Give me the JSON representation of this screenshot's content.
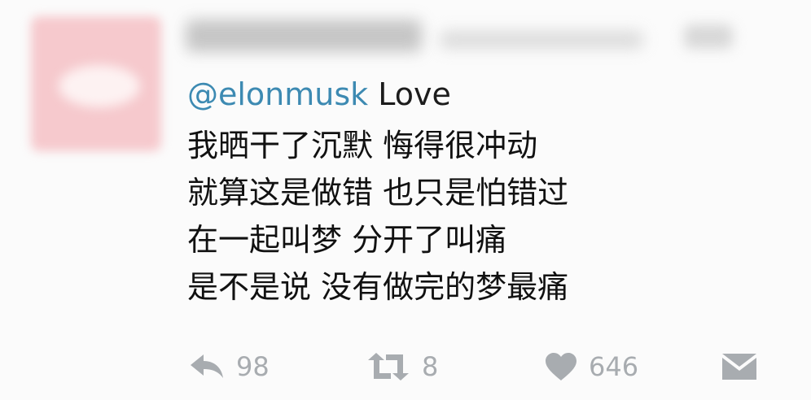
{
  "tweet": {
    "mention": "@elonmusk",
    "first_line_text": " Love",
    "lines": [
      "我晒干了沉默 悔得很冲动",
      "就算这是做错 也只是怕错过",
      "在一起叫梦 分开了叫痛",
      "是不是说 没有做完的梦最痛"
    ]
  },
  "actions": {
    "reply": {
      "icon": "reply-icon",
      "count": "98"
    },
    "retweet": {
      "icon": "retweet-icon",
      "count": "8"
    },
    "like": {
      "icon": "heart-icon",
      "count": "646"
    },
    "message": {
      "icon": "envelope-icon"
    }
  },
  "colors": {
    "mention": "#3d8ab2",
    "text": "#111111",
    "icon": "#a8acb0",
    "avatar": "#f6c9cd"
  }
}
